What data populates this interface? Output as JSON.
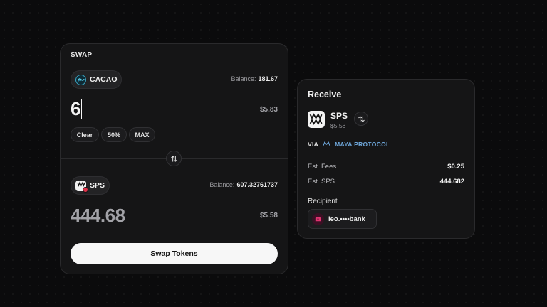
{
  "swap": {
    "title": "SWAP",
    "from": {
      "token": "CACAO",
      "balance_label": "Balance:",
      "balance_value": "181.67",
      "amount": "6",
      "usd": "$5.83"
    },
    "quick_buttons": {
      "clear": "Clear",
      "half": "50%",
      "max": "MAX"
    },
    "to": {
      "token": "SPS",
      "balance_label": "Balance:",
      "balance_value": "607.32761737",
      "amount": "444.68",
      "usd": "$5.58"
    },
    "submit_label": "Swap Tokens"
  },
  "receive": {
    "title": "Receive",
    "token": "SPS",
    "usd": "$5.58",
    "via_label": "VIA",
    "protocol": "MAYA PROTOCOL",
    "fees_label": "Est. Fees",
    "fees_value": "$0.25",
    "est_label": "Est. SPS",
    "est_value": "444.682",
    "recipient_label": "Recipient",
    "recipient_value": "leo.••••bank"
  },
  "icons": {
    "cacao": "cacao-token-icon",
    "sps": "sps-token-icon",
    "flip": "swap-arrows-icon",
    "maya": "maya-protocol-icon",
    "recipient": "leo-avatar-icon"
  },
  "colors": {
    "background": "#0b0b0c",
    "card": "#151516",
    "primary_button": "#f7f7f7",
    "protocol_accent": "#6fa8dc",
    "sps_badge": "#e0324a"
  }
}
